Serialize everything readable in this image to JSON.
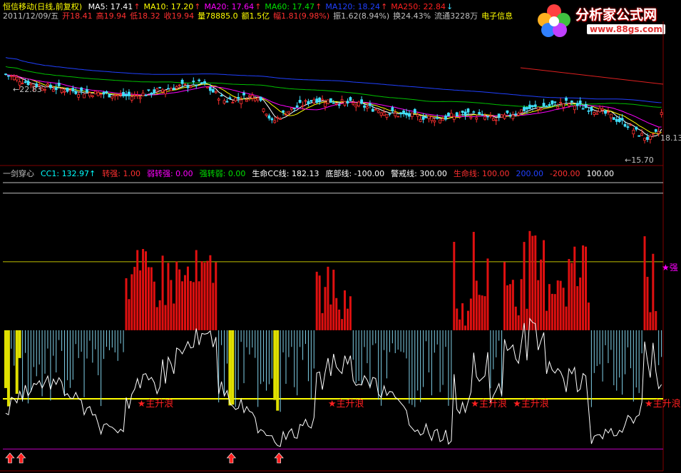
{
  "header": {
    "stock": "恒信移动(日线,前复权)",
    "ma": [
      {
        "label": "MA5: 17.41",
        "color": "#ffffff",
        "arrow": "up"
      },
      {
        "label": "MA10: 17.20",
        "color": "#ffff00",
        "arrow": "up"
      },
      {
        "label": "MA20: 17.64",
        "color": "#ff00ff",
        "arrow": "up"
      },
      {
        "label": "MA60: 17.47",
        "color": "#00e000",
        "arrow": "up"
      },
      {
        "label": "MA120: 18.24",
        "color": "#2040ff",
        "arrow": "up"
      },
      {
        "label": "MA250: 22.84",
        "color": "#ff2020",
        "arrow": "down"
      }
    ],
    "quote": [
      {
        "text": "2011/12/09/五",
        "color": "#c0c0c0"
      },
      {
        "text": "开18.41",
        "color": "#ff3030"
      },
      {
        "text": "高19.94",
        "color": "#ff3030"
      },
      {
        "text": "低18.32",
        "color": "#ff3030"
      },
      {
        "text": "收19.94",
        "color": "#ff3030"
      },
      {
        "text": "量78885.0",
        "color": "#ffff00"
      },
      {
        "text": "额1.5亿",
        "color": "#ffff00"
      },
      {
        "text": "幅1.81(9.98%)",
        "color": "#ff3030"
      },
      {
        "text": "振1.62(8.94%)",
        "color": "#c0c0c0"
      },
      {
        "text": "换24.43%",
        "color": "#c0c0c0"
      },
      {
        "text": "流通3228万",
        "color": "#c0c0c0"
      },
      {
        "text": "电子信息",
        "color": "#ffff00"
      }
    ]
  },
  "price_labels": {
    "high": "22.83",
    "low": "15.70",
    "last": "18.13"
  },
  "indicator_header": [
    {
      "text": "一剑穿心",
      "color": "#c0c0c0"
    },
    {
      "text": "CC1: 132.97↑",
      "color": "#00ffff"
    },
    {
      "text": "转强: 1.00",
      "color": "#ff3030"
    },
    {
      "text": "弱转强: 0.00",
      "color": "#ff00ff"
    },
    {
      "text": "强转弱: 0.00",
      "color": "#00e000"
    },
    {
      "text": "生命CC线: 182.13",
      "color": "#ffffff"
    },
    {
      "text": "底部线: -100.00",
      "color": "#ffffff"
    },
    {
      "text": "警戒线: 300.00",
      "color": "#ffffff"
    },
    {
      "text": "生命线: 100.00",
      "color": "#ff3030"
    },
    {
      "text": "200.00",
      "color": "#2040ff"
    },
    {
      "text": "-200.00",
      "color": "#ff3030"
    },
    {
      "text": "100.00",
      "color": "#ffffff"
    }
  ],
  "signals": {
    "main_rise": "★主升浪",
    "strong": "★强",
    "main_rise_positions": [
      48,
      116,
      167,
      182,
      229
    ],
    "buy_arrow_positions": [
      1,
      5,
      80,
      97
    ]
  },
  "logo": {
    "title": "分析家公式网",
    "url": "www.88gs.com"
  },
  "colors": {
    "up": "#ff3030",
    "down": "#40e0ff",
    "bg": "#000000"
  },
  "chart_data": [
    {
      "type": "candlestick",
      "ylim": [
        15.0,
        23.5
      ],
      "candles": [],
      "ma_series": [
        "MA5",
        "MA10",
        "MA20",
        "MA60",
        "MA120",
        "MA250"
      ]
    },
    {
      "type": "bar",
      "ylim": [
        -300,
        320
      ],
      "reference_lines": [
        300,
        182.13,
        100,
        0,
        -200
      ],
      "cc1_last": 132.97,
      "values": []
    }
  ]
}
